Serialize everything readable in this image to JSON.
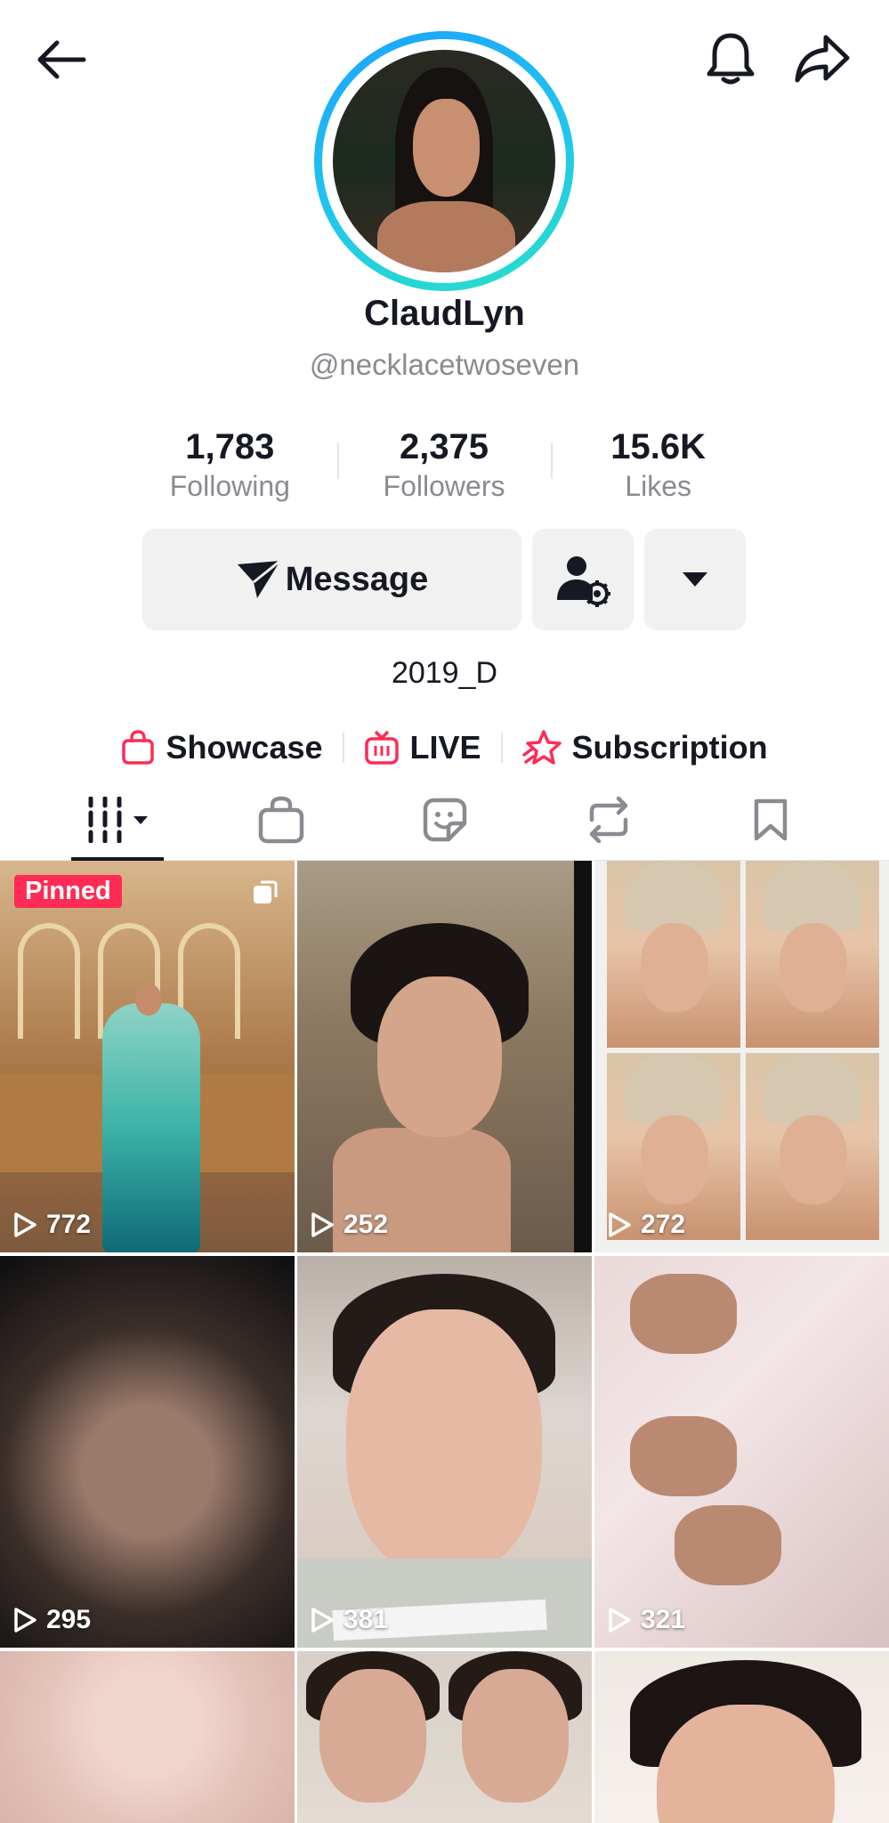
{
  "header": {
    "back_icon": "arrow-left-icon",
    "bell_icon": "bell-icon",
    "share_icon": "share-arrow-icon"
  },
  "profile": {
    "display_name": "ClaudLyn",
    "handle": "@necklacetwoseven",
    "bio": "2019_D"
  },
  "stats": [
    {
      "value": "1,783",
      "label": "Following"
    },
    {
      "value": "2,375",
      "label": "Followers"
    },
    {
      "value": "15.6K",
      "label": "Likes"
    }
  ],
  "actions": {
    "message_label": "Message",
    "message_icon": "send-icon",
    "person_icon": "person-settings-icon",
    "more_icon": "caret-down-icon"
  },
  "links": [
    {
      "label": "Showcase",
      "icon": "shopping-bag-icon",
      "color": "#fe2c55"
    },
    {
      "label": "LIVE",
      "icon": "live-tv-icon",
      "color": "#fe2c55"
    },
    {
      "label": "Subscription",
      "icon": "star-icon",
      "color": "#fe2c55"
    }
  ],
  "tabs": [
    {
      "icon": "videos-grid-icon",
      "active": true
    },
    {
      "icon": "shopping-bag-icon",
      "active": false
    },
    {
      "icon": "sticker-icon",
      "active": false
    },
    {
      "icon": "repost-icon",
      "active": false
    },
    {
      "icon": "bookmark-icon",
      "active": false
    }
  ],
  "videos": [
    {
      "views": "772",
      "pinned_label": "Pinned"
    },
    {
      "views": "252"
    },
    {
      "views": "272"
    },
    {
      "views": "295"
    },
    {
      "views": "381"
    },
    {
      "views": "321"
    },
    {
      "views": ""
    },
    {
      "views": ""
    },
    {
      "views": ""
    }
  ],
  "colors": {
    "accent": "#fe2c55",
    "text": "#161823",
    "muted": "#8a8b91",
    "button_bg": "#f1f1f2",
    "avatar_ring_start": "#1aa3ff",
    "avatar_ring_end": "#29e0c6"
  }
}
